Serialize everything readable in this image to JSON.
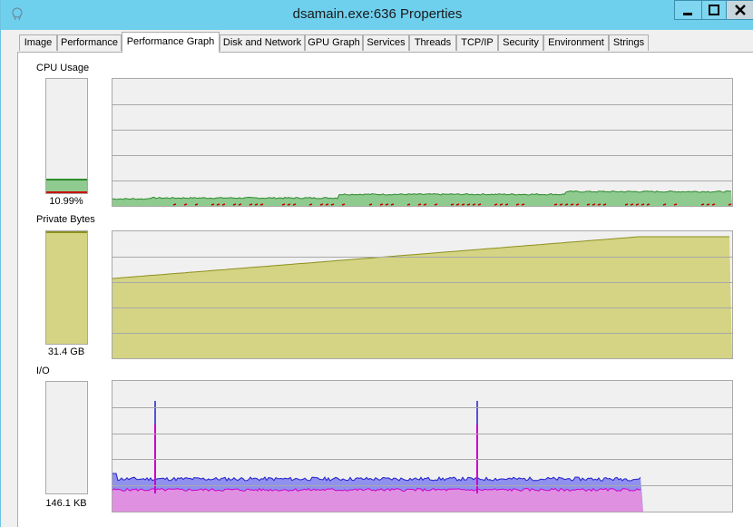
{
  "window": {
    "title": "dsamain.exe:636 Properties"
  },
  "tabs": [
    {
      "label": "Image",
      "active": false
    },
    {
      "label": "Performance",
      "active": false
    },
    {
      "label": "Performance Graph",
      "active": true
    },
    {
      "label": "Disk and Network",
      "active": false
    },
    {
      "label": "GPU Graph",
      "active": false
    },
    {
      "label": "Services",
      "active": false
    },
    {
      "label": "Threads",
      "active": false
    },
    {
      "label": "TCP/IP",
      "active": false
    },
    {
      "label": "Security",
      "active": false
    },
    {
      "label": "Environment",
      "active": false
    },
    {
      "label": "Strings",
      "active": false
    }
  ],
  "graphs": {
    "cpu": {
      "label": "CPU Usage",
      "value": "10.99%",
      "level": 0.11,
      "kernel_level": 0.02,
      "color_fill": "#8fca8f",
      "color_line": "#2e8b2e",
      "color_kernel": "#cc0000"
    },
    "private_bytes": {
      "label": "Private Bytes",
      "value": "31.4 GB",
      "level": 0.98,
      "color_fill": "#d4d484",
      "color_line": "#8f8f20"
    },
    "io": {
      "label": "I/O",
      "value": "146.1  KB",
      "level": 0.0,
      "color_fill": "#9090ee",
      "color_line": "#2020cc",
      "color_other_fill": "#e090e0",
      "color_other_line": "#cc00cc"
    }
  },
  "colors": {
    "titlebar": "#6fd0ee",
    "grid": "#a9a9a9",
    "graph_bg": "#f0f0f0"
  }
}
